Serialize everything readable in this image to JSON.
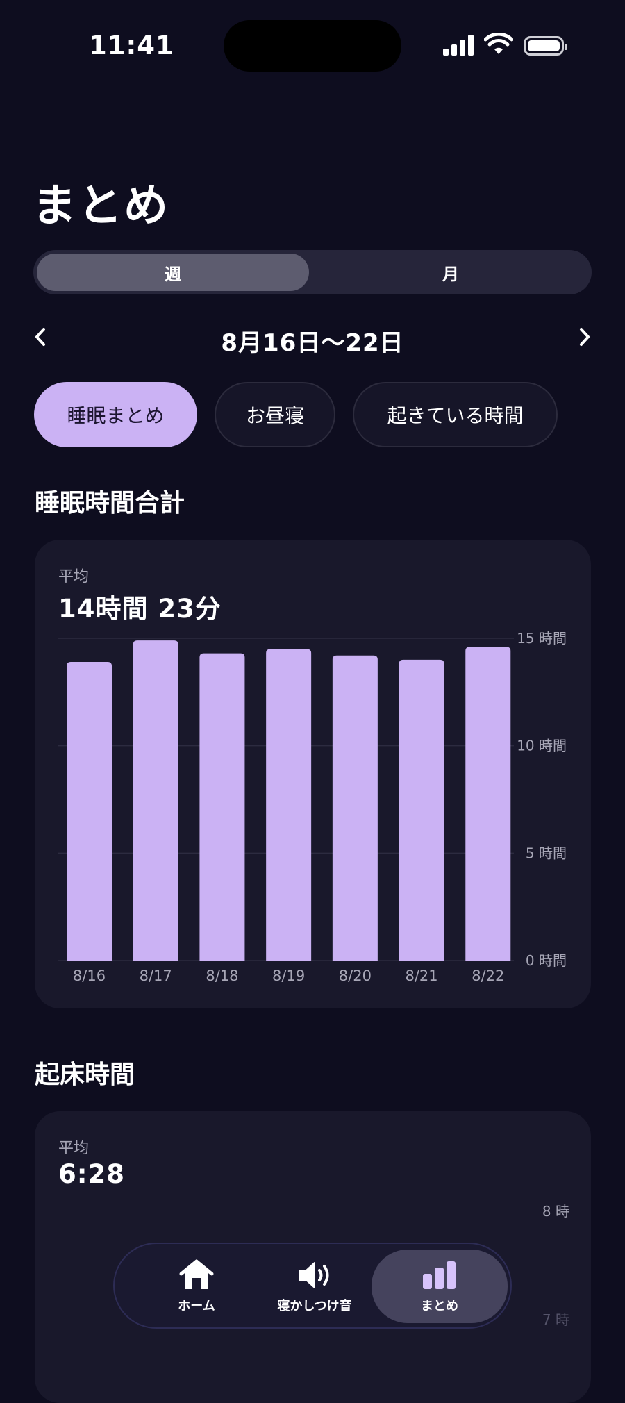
{
  "status_bar": {
    "time": "11:41"
  },
  "page_title": "まとめ",
  "segment": {
    "week": "週",
    "month": "月",
    "selected": "週"
  },
  "date_nav": {
    "range": "8月16日～22日"
  },
  "filters": [
    "睡眠まとめ",
    "お昼寝",
    "起きている時間"
  ],
  "sleep_total": {
    "heading": "睡眠時間合計",
    "avg_label": "平均",
    "avg_value": "14時間 23分"
  },
  "wake_time": {
    "heading": "起床時間",
    "avg_label": "平均",
    "avg_value": "6:28",
    "y_ticks": [
      "8 時",
      "7 時"
    ]
  },
  "chart_data": {
    "type": "bar",
    "categories": [
      "8/16",
      "8/17",
      "8/18",
      "8/19",
      "8/20",
      "8/21",
      "8/22"
    ],
    "values": [
      13.9,
      14.9,
      14.3,
      14.5,
      14.2,
      14.0,
      14.6
    ],
    "ylim": [
      0,
      15
    ],
    "y_ticks": [
      "0 時間",
      "5 時間",
      "10 時間",
      "15 時間"
    ],
    "y_tick_values": [
      0,
      5,
      10,
      15
    ],
    "bar_color": "#cbb2f4",
    "grid": true
  },
  "tab_bar": {
    "items": [
      {
        "label": "ホーム",
        "icon": "home-icon"
      },
      {
        "label": "寝かしつけ音",
        "icon": "speaker-icon"
      },
      {
        "label": "まとめ",
        "icon": "bar-chart-icon"
      }
    ],
    "selected": "まとめ",
    "accent": "#d7c3fb"
  }
}
